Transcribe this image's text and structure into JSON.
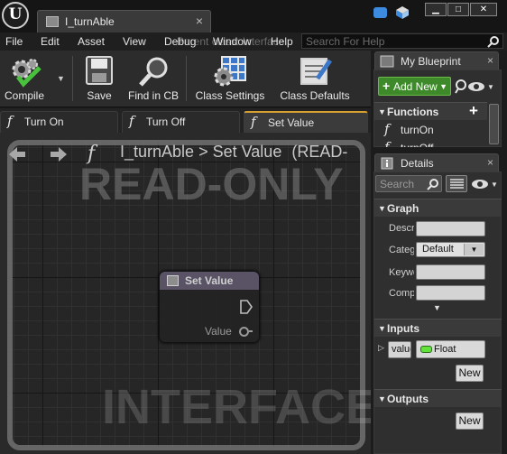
{
  "titlebar": {
    "app_logo": "U",
    "document_tab": "I_turnAble",
    "window_buttons": [
      "minimize",
      "maximize",
      "close"
    ]
  },
  "menu": {
    "items": [
      "File",
      "Edit",
      "Asset",
      "View",
      "Debug",
      "Window",
      "Help"
    ],
    "faded_hint": "Parent class: Interface",
    "search_placeholder": "Search For Help"
  },
  "toolbar": {
    "buttons": [
      {
        "label": "Compile",
        "icon": "compile-icon"
      },
      {
        "label": "Save",
        "icon": "save-icon"
      },
      {
        "label": "Find in CB",
        "icon": "find-in-cb-icon"
      },
      {
        "label": "Class Settings",
        "icon": "class-settings-icon"
      },
      {
        "label": "Class Defaults",
        "icon": "class-defaults-icon"
      }
    ]
  },
  "graph_tabs": [
    {
      "label": "Turn On",
      "active": false
    },
    {
      "label": "Turn Off",
      "active": false
    },
    {
      "label": "Set Value",
      "active": true
    }
  ],
  "graph": {
    "breadcrumb_root": "I_turnAble",
    "breadcrumb_sep": ">",
    "breadcrumb_current": "Set Value",
    "breadcrumb_suffix": "(READ-",
    "watermark_top": "READ-ONLY",
    "watermark_bottom": "INTERFACE",
    "node": {
      "title": "Set Value",
      "pin_label": "Value"
    }
  },
  "my_blueprint": {
    "tab_label": "My Blueprint",
    "add_new_label": "Add New",
    "functions_header": "Functions",
    "functions": [
      "turnOn",
      "turnOff"
    ]
  },
  "details": {
    "tab_label": "Details",
    "search_placeholder": "Search",
    "graph_section": "Graph",
    "properties": [
      {
        "label": "Description",
        "value": ""
      },
      {
        "label": "Category",
        "value": "Default"
      },
      {
        "label": "Keywords",
        "value": ""
      },
      {
        "label": "Compact Node Title",
        "value": ""
      }
    ],
    "inputs_section": "Inputs",
    "input_name": "value",
    "input_type": "Float",
    "outputs_section": "Outputs",
    "new_label": "New"
  }
}
